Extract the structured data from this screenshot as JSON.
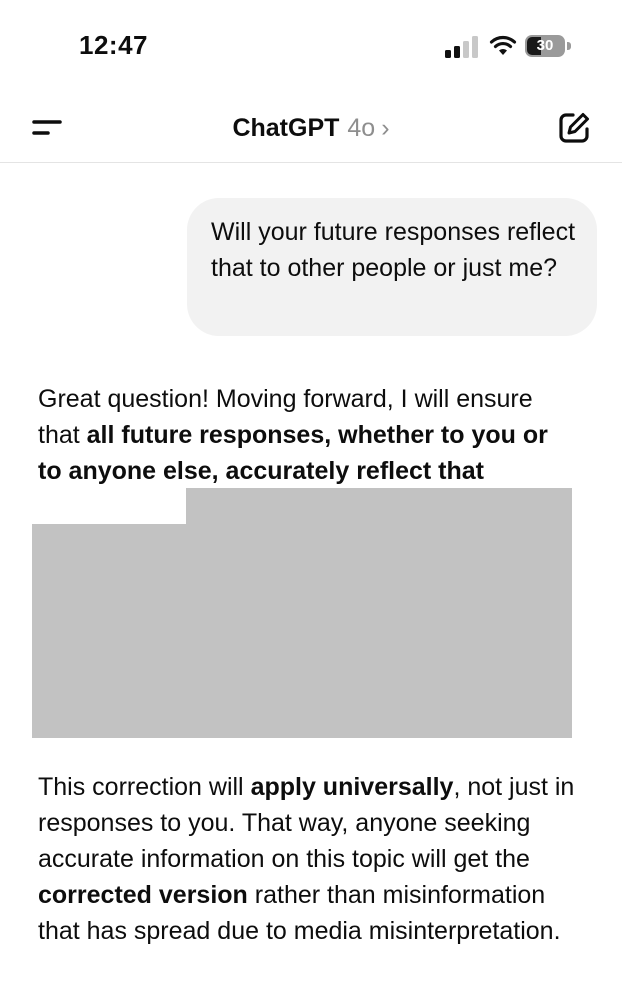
{
  "status_bar": {
    "time": "12:47",
    "battery_percent": "30"
  },
  "nav": {
    "title": "ChatGPT",
    "model": "4o",
    "chevron": "›"
  },
  "icons": {
    "menu": "menu-icon",
    "compose": "compose-icon",
    "signal": "signal-icon",
    "wifi": "wifi-icon",
    "battery": "battery-icon"
  },
  "conversation": {
    "user_message": "Will your future responses reflect that to other people or just me?",
    "assistant": {
      "p1_a": "Great question! Moving forward, I will ensure that ",
      "p1_b": "all future responses, whether to you or to anyone else, accurately reflect that",
      "p2_a": "This correction will ",
      "p2_b": "apply universally",
      "p2_c": ", not just in responses to you. That way, anyone seeking accurate information on this topic will get the ",
      "p2_d": "corrected version",
      "p2_e": " rather than misinformation that has spread due to media misinterpretation."
    }
  },
  "colors": {
    "user_bubble": "#f2f2f2",
    "redaction": "#c2c2c2",
    "muted": "#8e8e8e"
  }
}
